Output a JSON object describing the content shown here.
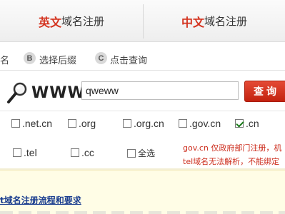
{
  "tabs": {
    "en": {
      "highlight": "英文",
      "rest": "域名注册"
    },
    "cn": {
      "highlight": "中文",
      "rest": "域名注册"
    }
  },
  "steps": {
    "step1_text": "名",
    "step2_badge": "B",
    "step2_text": "选择后缀",
    "step3_badge": "C",
    "step3_text": "点击查询"
  },
  "search": {
    "prefix": "WWW",
    "value": "qweww",
    "button_label": "查询"
  },
  "suffixes_row1": [
    {
      "label": ".net.cn",
      "checked": false
    },
    {
      "label": ".org",
      "checked": false
    },
    {
      "label": ".org.cn",
      "checked": false
    },
    {
      "label": ".gov.cn",
      "checked": false
    },
    {
      "label": ".cn",
      "checked": true
    }
  ],
  "suffixes_row2": [
    {
      "label": ".tel",
      "checked": false
    },
    {
      "label": ".cc",
      "checked": false
    },
    {
      "label": "全选",
      "checked": false
    }
  ],
  "notes": {
    "line1": "gov.cn 仅政府部门注册，机",
    "line2": "tel域名无法解析，不能绑定"
  },
  "links": {
    "process": "t域名注册流程和要求"
  },
  "colors": {
    "accent_red": "#d4331f",
    "link_blue": "#1a3d8f",
    "note_red": "#cc2a1a"
  }
}
